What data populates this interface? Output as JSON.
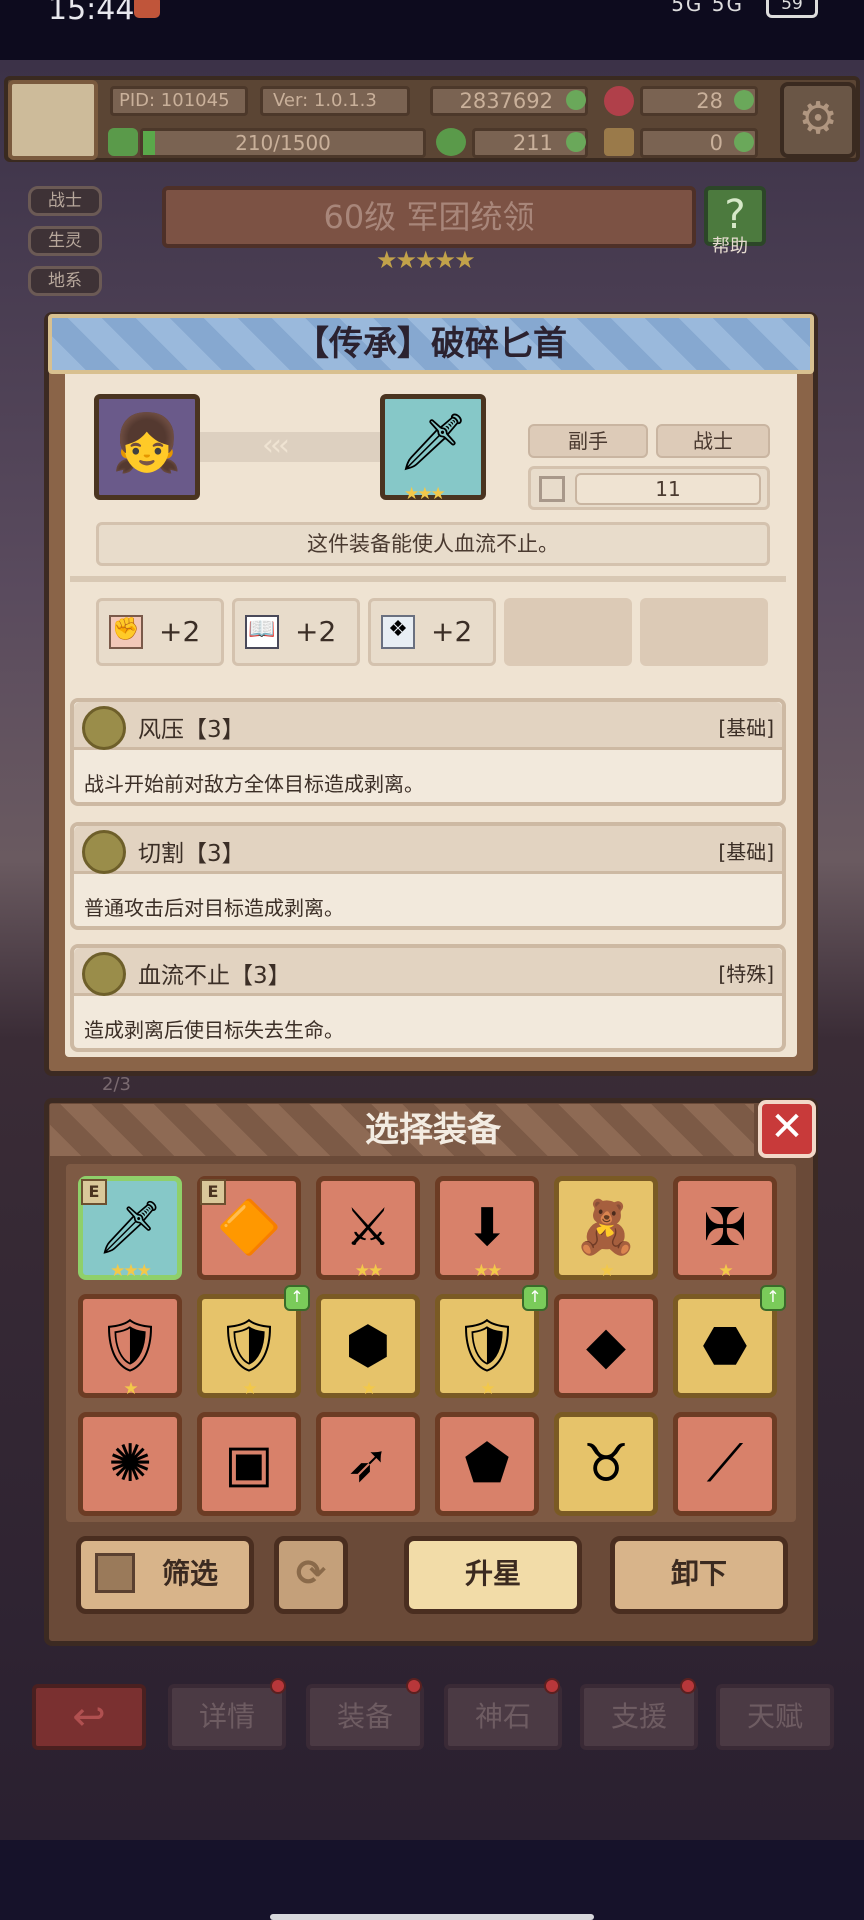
{
  "status_bar": {
    "time": "15:44",
    "signal": "5G 5G",
    "battery": "59"
  },
  "top_bar": {
    "pid": "PID: 101045",
    "version": "Ver: 1.0.1.3",
    "gold": "2837692",
    "gems": "28",
    "exp": "210/1500",
    "clover": "211",
    "key": "0"
  },
  "side_tabs": [
    "战士",
    "生灵",
    "地系"
  ],
  "level_banner": "60级 军团统领",
  "help_label": "帮助",
  "detail": {
    "title": "【传承】破碎匕首",
    "slot_label": "副手",
    "class_label": "战士",
    "power": "11",
    "description": "这件装备能使人血流不止。",
    "stats": [
      "+2",
      "+2",
      "+2"
    ],
    "skills": [
      {
        "name": "风压【3】",
        "tag": "[基础]",
        "desc": "战斗开始前对敌方全体目标造成剥离。"
      },
      {
        "name": "切割【3】",
        "tag": "[基础]",
        "desc": "普通攻击后对目标造成剥离。"
      },
      {
        "name": "血流不止【3】",
        "tag": "[特殊]",
        "desc": "造成剥离后使目标失去生命。"
      }
    ]
  },
  "behind_counter": "2/3",
  "select_panel": {
    "title": "选择装备",
    "filter_label": "筛选",
    "upgrade_label": "升星",
    "unequip_label": "卸下",
    "items": [
      {
        "icon": "dagger-icon",
        "glyph": "🗡",
        "stars": "★★★",
        "badge": "E",
        "style": "sel",
        "up": false
      },
      {
        "icon": "brooch-icon",
        "glyph": "🔶",
        "stars": "",
        "badge": "E",
        "style": "",
        "up": false
      },
      {
        "icon": "crossed-swords-icon",
        "glyph": "⚔",
        "stars": "★★",
        "badge": "",
        "style": "",
        "up": false
      },
      {
        "icon": "spear-icon",
        "glyph": "⬇",
        "stars": "★★",
        "badge": "",
        "style": "",
        "up": false
      },
      {
        "icon": "bear-icon",
        "glyph": "🧸",
        "stars": "★",
        "badge": "",
        "style": "gold",
        "up": false
      },
      {
        "icon": "cross-sword-icon",
        "glyph": "✠",
        "stars": "★",
        "badge": "",
        "style": "",
        "up": false
      },
      {
        "icon": "gold-shield-icon",
        "glyph": "🛡",
        "stars": "★",
        "badge": "",
        "style": "",
        "up": false
      },
      {
        "icon": "flame-shield-icon",
        "glyph": "🛡",
        "stars": "★",
        "badge": "",
        "style": "gold",
        "up": true
      },
      {
        "icon": "jade-shield-icon",
        "glyph": "⬢",
        "stars": "★",
        "badge": "",
        "style": "gold",
        "up": false
      },
      {
        "icon": "crest-shield-icon",
        "glyph": "🛡",
        "stars": "★",
        "badge": "",
        "style": "gold",
        "up": true
      },
      {
        "icon": "crystal-icon",
        "glyph": "◆",
        "stars": "",
        "badge": "",
        "style": "",
        "up": false
      },
      {
        "icon": "ice-shield-icon",
        "glyph": "⬣",
        "stars": "",
        "badge": "",
        "style": "gold",
        "up": true
      },
      {
        "icon": "round-shield-icon",
        "glyph": "✺",
        "stars": "",
        "badge": "",
        "style": "",
        "up": false
      },
      {
        "icon": "armor-icon",
        "glyph": "▣",
        "stars": "",
        "badge": "",
        "style": "",
        "up": false
      },
      {
        "icon": "javelin-icon",
        "glyph": "➶",
        "stars": "",
        "badge": "",
        "style": "",
        "up": false
      },
      {
        "icon": "stone-shield-icon",
        "glyph": "⬟",
        "stars": "",
        "badge": "",
        "style": "",
        "up": false
      },
      {
        "icon": "horned-shield-icon",
        "glyph": "♉",
        "stars": "",
        "badge": "",
        "style": "gold",
        "up": false
      },
      {
        "icon": "knife-icon",
        "glyph": "⟋",
        "stars": "",
        "badge": "",
        "style": "",
        "up": false
      }
    ]
  },
  "bottom_nav": [
    "详情",
    "装备",
    "神石",
    "支援",
    "天赋"
  ]
}
